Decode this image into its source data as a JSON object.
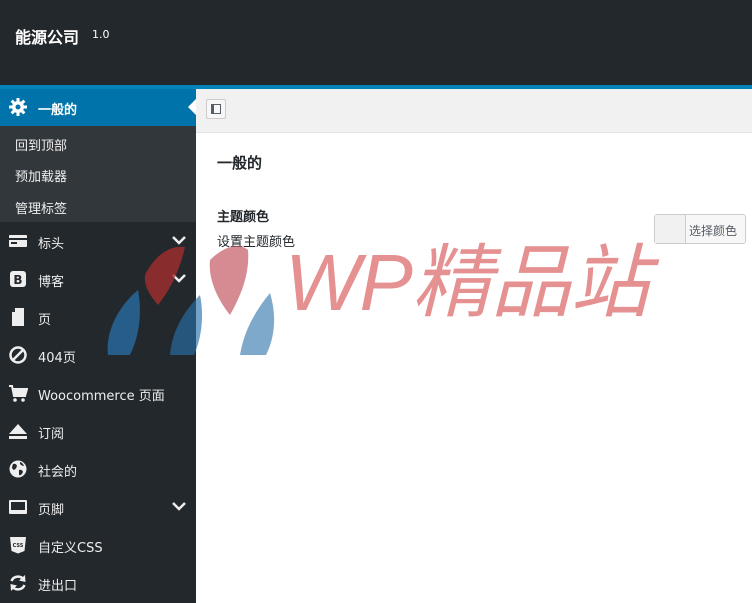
{
  "header": {
    "brand": "能源公司",
    "version": "1.0"
  },
  "sidebar": {
    "active": {
      "label": "一般的",
      "icon": "gear-icon"
    },
    "submenu": [
      "回到顶部",
      "预加载器",
      "管理标签"
    ],
    "items": [
      {
        "label": "标头",
        "icon": "header-icon",
        "has_chevron": true
      },
      {
        "label": "博客",
        "icon": "blog-icon",
        "has_chevron": true
      },
      {
        "label": "页",
        "icon": "page-icon",
        "has_chevron": false
      },
      {
        "label": "404页",
        "icon": "forbidden-icon",
        "has_chevron": false
      },
      {
        "label": "Woocommerce 页面",
        "icon": "cart-icon",
        "has_chevron": false
      },
      {
        "label": "订阅",
        "icon": "eject-icon",
        "has_chevron": false
      },
      {
        "label": "社会的",
        "icon": "globe-icon",
        "has_chevron": false
      },
      {
        "label": "页脚",
        "icon": "footer-icon",
        "has_chevron": true
      },
      {
        "label": "自定义CSS",
        "icon": "css-icon",
        "has_chevron": false
      },
      {
        "label": "进出口",
        "icon": "sync-icon",
        "has_chevron": false
      }
    ]
  },
  "main": {
    "section_title": "一般的",
    "field": {
      "label": "主题颜色",
      "description": "设置主题颜色",
      "button_label": "选择颜色"
    }
  },
  "watermark": {
    "text": "WP精品站"
  },
  "colors": {
    "sidebar_bg": "#23282d",
    "submenu_bg": "#32373c",
    "active_bg": "#0073aa",
    "accent_line": "#0085ba",
    "watermark_red": "#da6262",
    "watermark_blue": "#2a6fa8"
  }
}
